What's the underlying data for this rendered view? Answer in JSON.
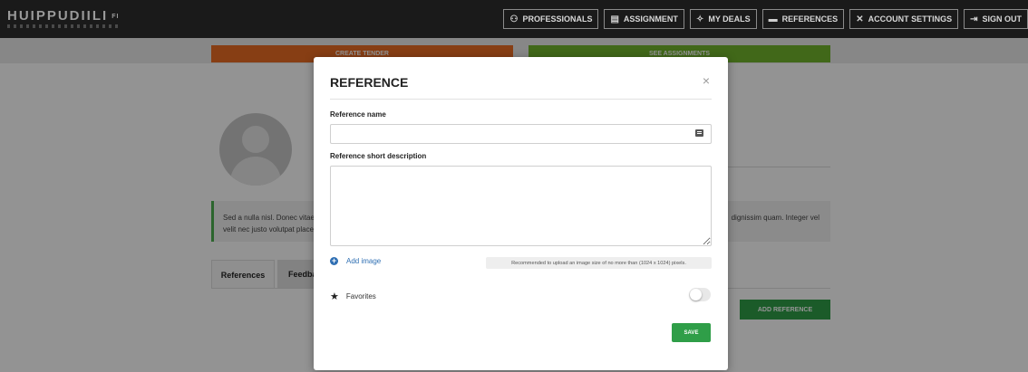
{
  "header": {
    "logo": "HUIPPUDIILI",
    "logo_suffix": "FI",
    "nav": [
      {
        "label": "PROFESSIONALS",
        "icon": "users-icon"
      },
      {
        "label": "ASSIGNMENT",
        "icon": "document-icon"
      },
      {
        "label": "MY DEALS",
        "icon": "handshake-icon"
      },
      {
        "label": "REFERENCES",
        "icon": "folder-icon"
      },
      {
        "label": "ACCOUNT SETTINGS",
        "icon": "tools-icon"
      },
      {
        "label": "SIGN OUT",
        "icon": "sign-out-icon"
      }
    ]
  },
  "page": {
    "create_tender": "CREATE TENDER",
    "see_assignments": "SEE ASSIGNMENTS",
    "bio_left": "Sed a nulla nisl. Donec vitae\nvelit nec justo volutpat place",
    "bio_right": "dignissim quam. Integer vel",
    "tabs": [
      "References",
      "Feedba"
    ],
    "add_reference": "ADD REFERENCE"
  },
  "modal": {
    "title": "REFERENCE",
    "close": "×",
    "name_label": "Reference name",
    "name_value": "",
    "desc_label": "Reference short description",
    "desc_value": "",
    "add_image": "Add image",
    "upload_hint": "Recommended to upload an image size of no more than (1024 x 1024) pixels.",
    "favorites": "Favorites",
    "favorites_on": false,
    "save": "SAVE"
  },
  "colors": {
    "accent_orange": "#e96b23",
    "accent_green": "#71b42b",
    "save_green": "#2f9e48",
    "link_blue": "#2f6fb3"
  }
}
